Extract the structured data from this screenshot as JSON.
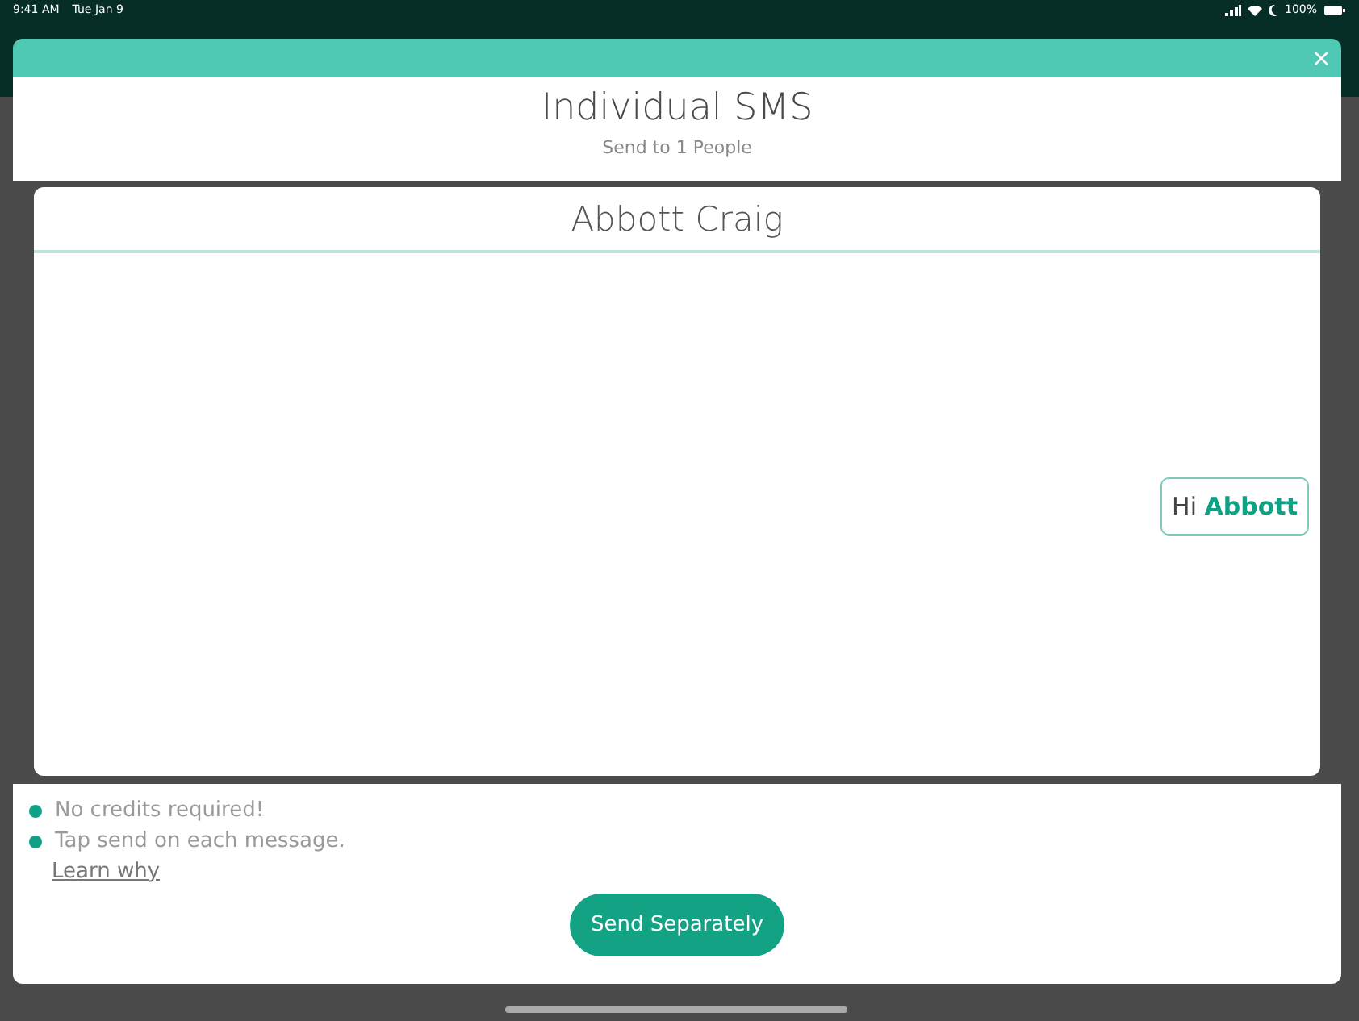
{
  "status_bar": {
    "time": "9:41 AM",
    "date": "Tue Jan 9",
    "battery": "100%"
  },
  "modal": {
    "close": "×",
    "title": "Individual SMS",
    "subtitle": "Send to 1 People"
  },
  "recipient": {
    "name": "Abbott Craig",
    "message": "Hi **Abbott**"
  },
  "notes": [
    "No credits required!",
    "Tap send on each message."
  ],
  "learn_link": "Learn why",
  "send_button": "Send Separately"
}
